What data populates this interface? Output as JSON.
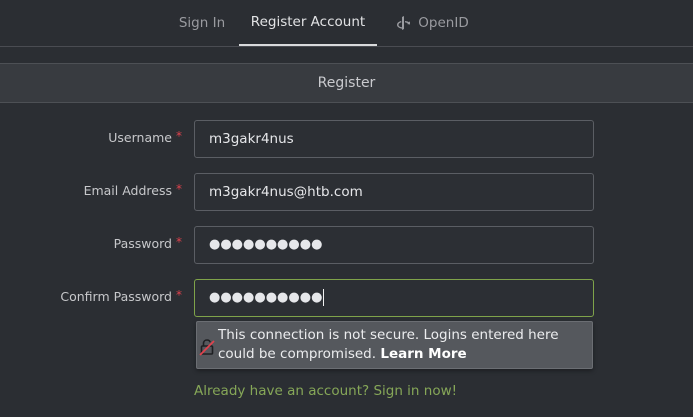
{
  "nav": {
    "tabs": [
      {
        "label": "Sign In",
        "active": false
      },
      {
        "label": "Register Account",
        "active": true
      },
      {
        "label": "OpenID",
        "active": false,
        "icon": "openid-icon"
      }
    ]
  },
  "card": {
    "title": "Register"
  },
  "form": {
    "required_mark": "*",
    "fields": [
      {
        "label": "Username",
        "value": "m3gakr4nus",
        "type": "text"
      },
      {
        "label": "Email Address",
        "value": "m3gakr4nus@htb.com",
        "type": "text"
      },
      {
        "label": "Password",
        "value": "●●●●●●●●●●",
        "type": "password"
      },
      {
        "label": "Confirm Password",
        "value": "●●●●●●●●●●",
        "type": "password",
        "focused": true
      }
    ]
  },
  "warning": {
    "icon": "insecure-lock-icon",
    "text": "This connection is not secure. Logins entered here could be compromised.",
    "link": "Learn More"
  },
  "footer": {
    "signin_link": "Already have an account? Sign in now!"
  },
  "colors": {
    "background": "#2b2e33",
    "accent_green": "#86a758",
    "required_red": "#e0424d"
  }
}
